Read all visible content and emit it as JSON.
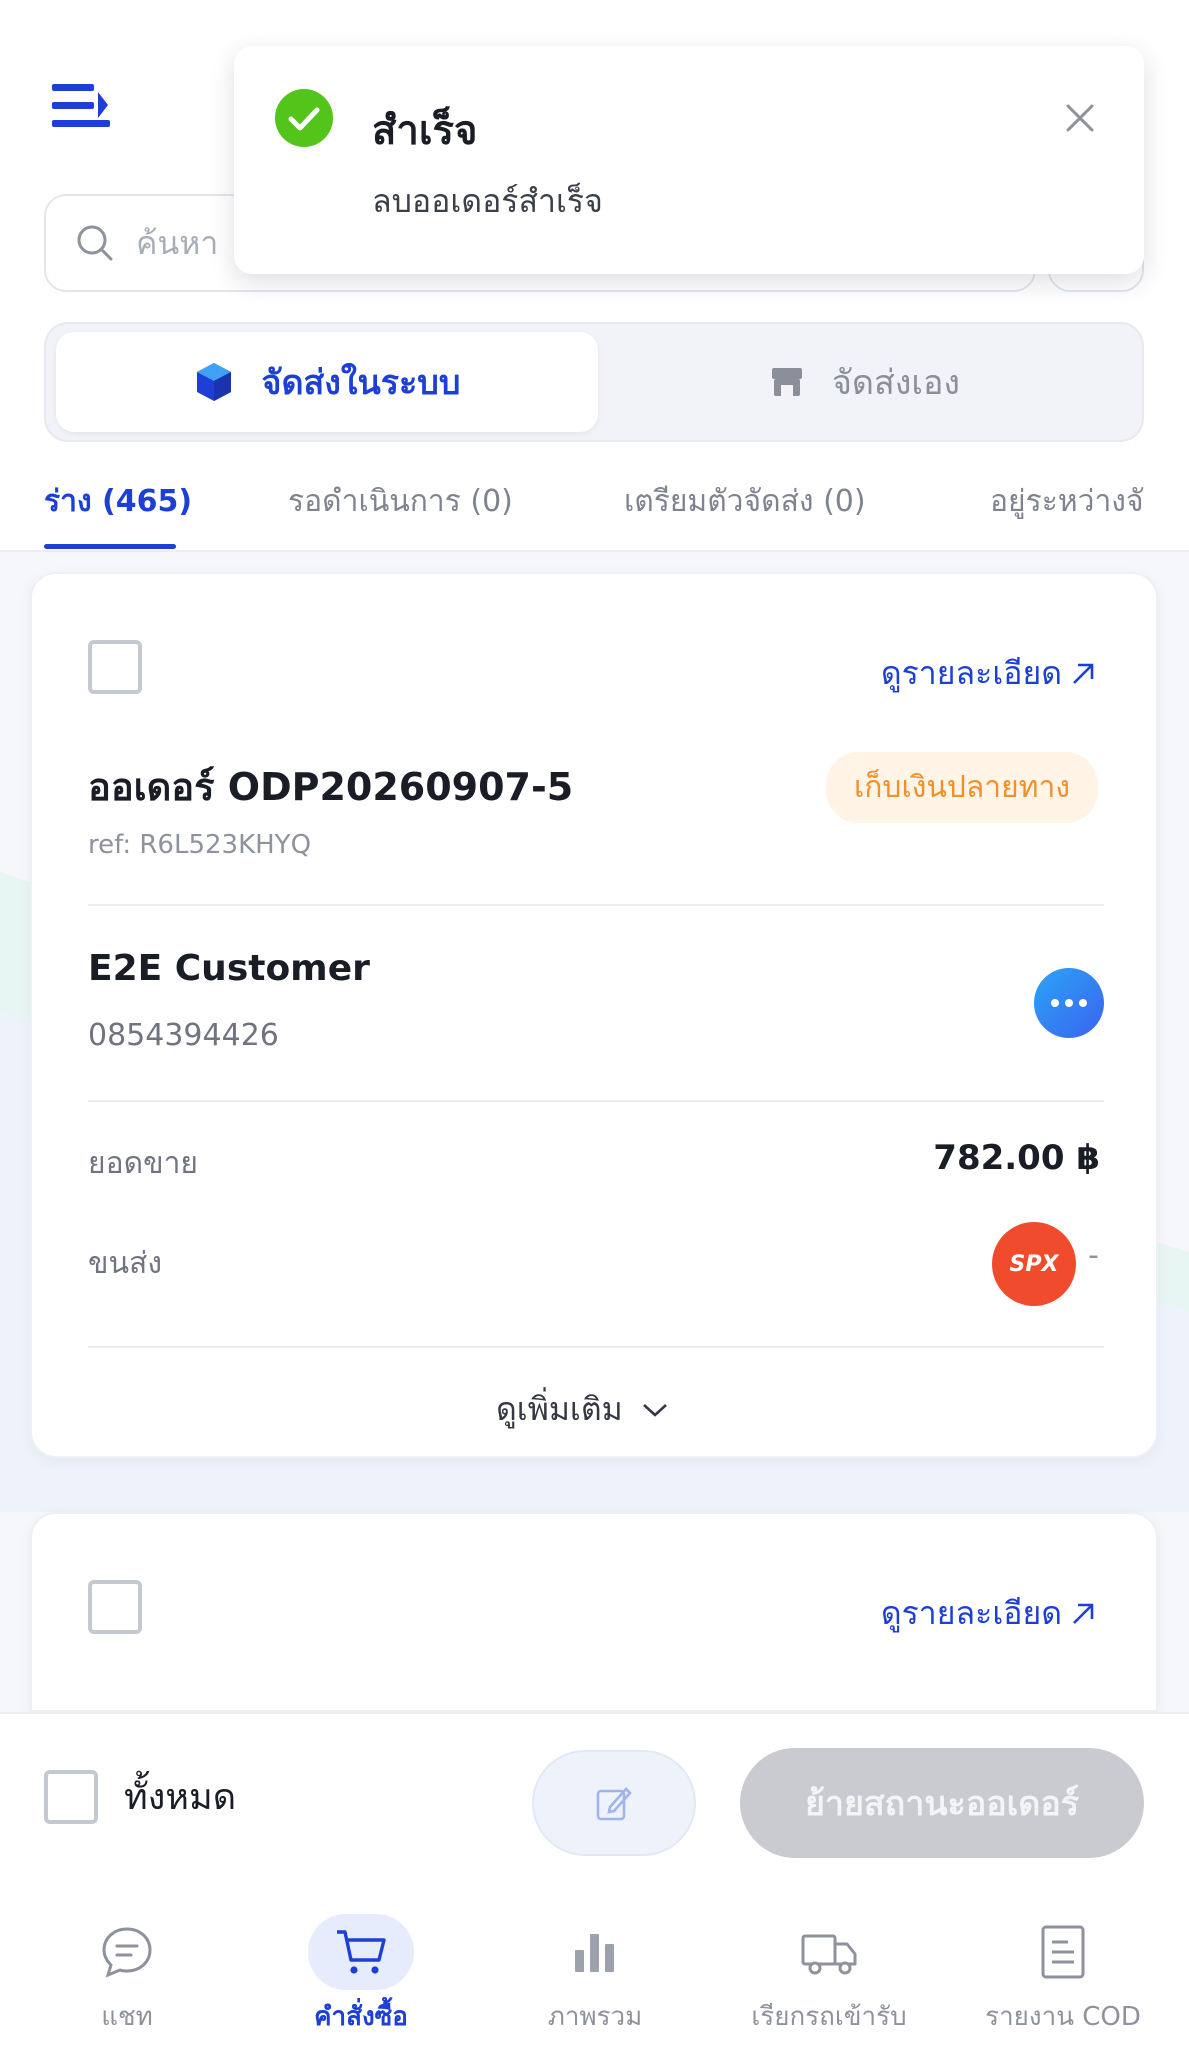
{
  "search": {
    "placeholder": "ค้นหา"
  },
  "segmented": {
    "system_shipping": "จัดส่งในระบบ",
    "self_shipping": "จัดส่งเอง"
  },
  "tabs": [
    {
      "label": "ร่าง (465)"
    },
    {
      "label": "รอดำเนินการ (0)"
    },
    {
      "label": "เตรียมตัวจัดส่ง (0)"
    },
    {
      "label": "อยู่ระหว่างจั"
    }
  ],
  "orders": [
    {
      "detail_label": "ดูรายละเอียด",
      "title": "ออเดอร์ ODP20260907-5",
      "badge": "เก็บเงินปลายทาง",
      "ref": "ref: R6L523KHYQ",
      "customer_name": "E2E Customer",
      "phone": "0854394426",
      "sales_label": "ยอดขาย",
      "sales_value": "782.00 ฿",
      "shipping_label": "ขนส่ง",
      "carrier_logo": "SPX",
      "shipping_value": "-",
      "see_more": "ดูเพิ่มเติม"
    },
    {
      "detail_label": "ดูรายละเอียด"
    }
  ],
  "action_bar": {
    "select_all": "ทั้งหมด",
    "move_status": "ย้ายสถานะออเดอร์"
  },
  "bottom_nav": [
    {
      "label": "แชท",
      "icon": "chat-icon"
    },
    {
      "label": "คำสั่งซื้อ",
      "icon": "cart-icon"
    },
    {
      "label": "ภาพรวม",
      "icon": "bar-chart-icon"
    },
    {
      "label": "เรียกรถเข้ารับ",
      "icon": "truck-icon"
    },
    {
      "label": "รายงาน COD",
      "icon": "report-icon"
    }
  ],
  "toast": {
    "title": "สำเร็จ",
    "message": "ลบออเดอร์สำเร็จ"
  },
  "colors": {
    "primary": "#1d3fd6",
    "success": "#52c41a",
    "cod_badge_text": "#f0902a",
    "spx": "#ef4b2c"
  }
}
